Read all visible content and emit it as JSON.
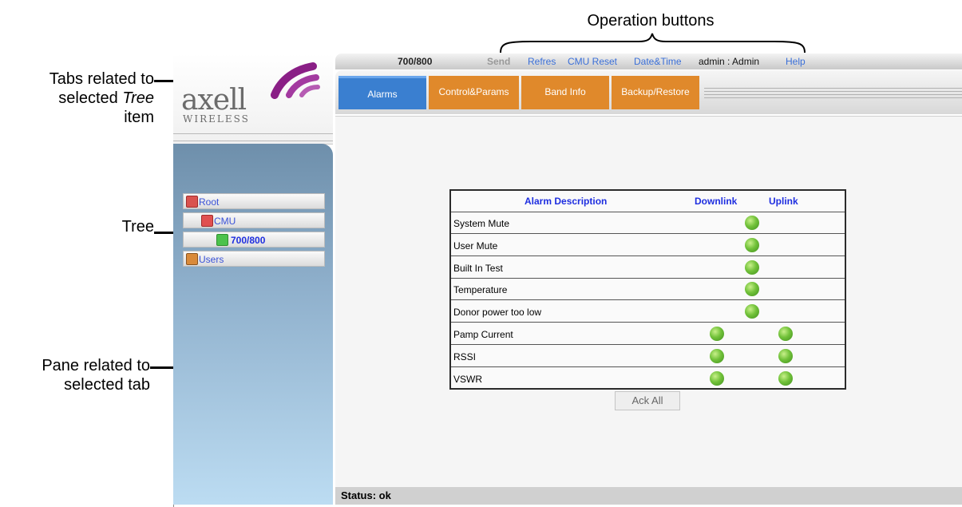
{
  "annotations": {
    "operation_buttons": "Operation buttons",
    "tabs_line1": "Tabs related to",
    "tabs_line2a": "selected ",
    "tabs_line2b": "Tree",
    "tabs_line3": "item",
    "tree": "Tree",
    "pane_line1": "Pane related to",
    "pane_line2": "selected tab"
  },
  "logo": {
    "name": "axell",
    "sub": "WIRELESS"
  },
  "toolbar": {
    "device": "700/800",
    "send": "Send",
    "refresh": "Refres",
    "cmu_reset": "CMU Reset",
    "datetime": "Date&Time",
    "user": "admin : Admin",
    "help": "Help"
  },
  "tabs": [
    {
      "label": "Alarms",
      "color": "#3a7fd0"
    },
    {
      "label": "Control&Params",
      "color": "#e0892b"
    },
    {
      "label": "Band Info",
      "color": "#e0892b"
    },
    {
      "label": "Backup/Restore",
      "color": "#e0892b"
    }
  ],
  "tree": {
    "root": "Root",
    "cmu": "CMU",
    "device": "700/800",
    "users": "Users"
  },
  "alarm_table": {
    "headers": {
      "description": "Alarm Description",
      "downlink": "Downlink",
      "uplink": "Uplink"
    },
    "rows": [
      {
        "name": "System Mute",
        "leds": [
          "center"
        ]
      },
      {
        "name": "User Mute",
        "leds": [
          "center"
        ]
      },
      {
        "name": "Built In Test",
        "leds": [
          "center"
        ]
      },
      {
        "name": "Temperature",
        "leds": [
          "center"
        ]
      },
      {
        "name": "Donor power too low",
        "leds": [
          "center"
        ]
      },
      {
        "name": "Pamp Current",
        "leds": [
          "downlink",
          "uplink"
        ]
      },
      {
        "name": "RSSI",
        "leds": [
          "downlink",
          "uplink"
        ]
      },
      {
        "name": "VSWR",
        "leds": [
          "downlink",
          "uplink"
        ]
      }
    ]
  },
  "ack_all": "Ack All",
  "status": "Status: ok",
  "colors": {
    "led_green": "#72c23a",
    "header_blue": "#1e2ee0",
    "tab_blue": "#3a7fd0",
    "tab_orange": "#e0892b"
  }
}
